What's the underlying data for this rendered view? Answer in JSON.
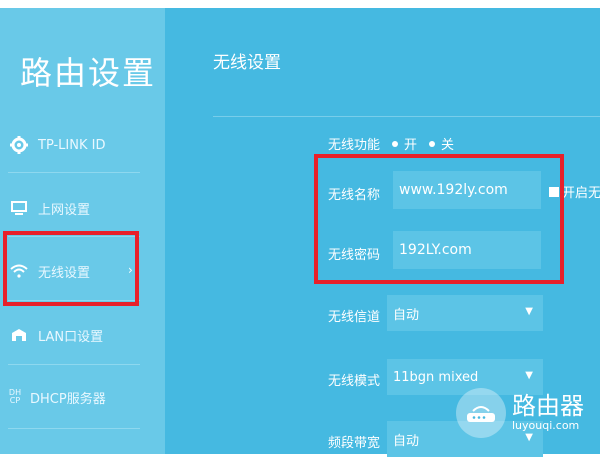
{
  "sidebar": {
    "title": "路由设置",
    "items": [
      {
        "label": "TP-LINK ID",
        "icon": "gear-icon"
      },
      {
        "label": "上网设置",
        "icon": "monitor-icon"
      },
      {
        "label": "无线设置",
        "icon": "wifi-icon",
        "selected": true,
        "chevron": "›"
      },
      {
        "label": "LAN口设置",
        "icon": "lan-icon"
      },
      {
        "label": "DHCP服务器",
        "icon": "dhcp-icon",
        "icon_text": "DH CP"
      }
    ]
  },
  "main": {
    "header": "无线设置",
    "wireless_function": {
      "label": "无线功能",
      "option_on": "开",
      "option_off": "关"
    },
    "ssid": {
      "label": "无线名称",
      "value": "www.192ly.com"
    },
    "password": {
      "label": "无线密码",
      "value": "192LY.com"
    },
    "channel": {
      "label": "无线信道",
      "value": "自动"
    },
    "mode": {
      "label": "无线模式",
      "value": "11bgn mixed"
    },
    "bandwidth": {
      "label": "频段带宽",
      "value": "自动"
    },
    "checkbox_label": "开启无"
  },
  "watermark": {
    "title": "路由器",
    "subtitle": "luyouqi.com"
  },
  "colors": {
    "sidebar_bg": "#69c9e8",
    "main_bg": "#45b9e1",
    "highlight": "#e8202a"
  }
}
